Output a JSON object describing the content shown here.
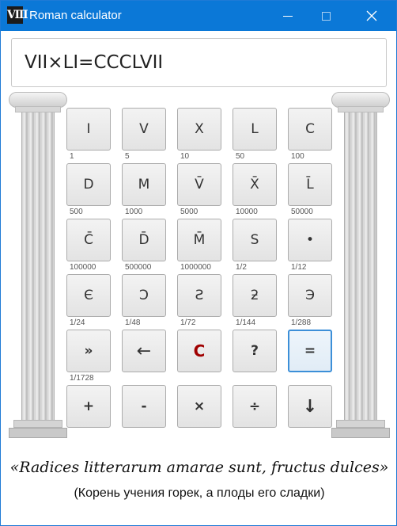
{
  "window": {
    "title": "Roman calculator",
    "icon_text": "Ⅷ",
    "accent": "#0b78d7"
  },
  "display": {
    "value": "VII×LI=CCCLVII"
  },
  "keys": [
    {
      "label": "I",
      "value": "1"
    },
    {
      "label": "V",
      "value": "5"
    },
    {
      "label": "X",
      "value": "10"
    },
    {
      "label": "L",
      "value": "50"
    },
    {
      "label": "C",
      "value": "100"
    },
    {
      "label": "D",
      "value": "500"
    },
    {
      "label": "M",
      "value": "1000"
    },
    {
      "label": "V̄",
      "value": "5000"
    },
    {
      "label": "X̄",
      "value": "10000"
    },
    {
      "label": "L̄",
      "value": "50000"
    },
    {
      "label": "C̄",
      "value": "100000"
    },
    {
      "label": "D̄",
      "value": "500000"
    },
    {
      "label": "M̄",
      "value": "1000000"
    },
    {
      "label": "S",
      "value": "1/2"
    },
    {
      "label": "•",
      "value": "1/12"
    },
    {
      "label": "Є",
      "value": "1/24"
    },
    {
      "label": "Ɔ",
      "value": "1/48"
    },
    {
      "label": "Ƨ",
      "value": "1/72"
    },
    {
      "label": "ƻ",
      "value": "1/144"
    },
    {
      "label": "Э",
      "value": "1/288"
    },
    {
      "label": "»",
      "value": "1/1728"
    },
    {
      "label": "←",
      "value": ""
    },
    {
      "label": "C",
      "value": ""
    },
    {
      "label": "?",
      "value": ""
    },
    {
      "label": "=",
      "value": ""
    },
    {
      "label": "+",
      "value": ""
    },
    {
      "label": "-",
      "value": ""
    },
    {
      "label": "×",
      "value": ""
    },
    {
      "label": "÷",
      "value": ""
    },
    {
      "label": "↓",
      "value": ""
    }
  ],
  "quote": "«Radices litterarum amarae sunt, fructus dulces»",
  "translation": "(Корень учения горек, а плоды его сладки)",
  "icons": {
    "minimize": "minimize-icon",
    "maximize": "maximize-icon",
    "close": "close-icon"
  }
}
